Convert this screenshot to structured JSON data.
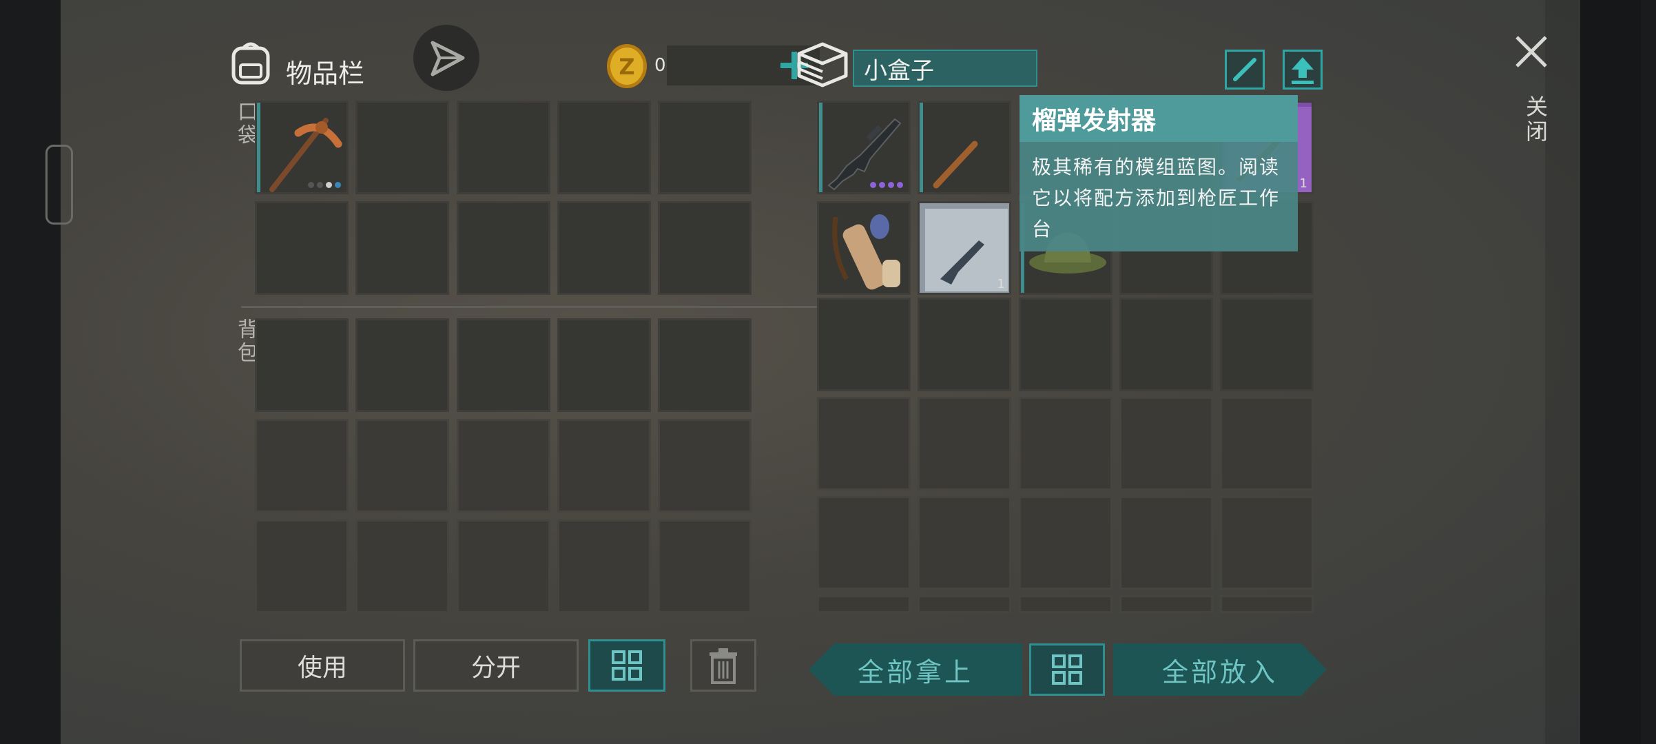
{
  "inventory": {
    "title": "物品栏",
    "pocket_label": "口袋",
    "backpack_label": "背包",
    "coins": "0"
  },
  "container": {
    "name": "小盒子"
  },
  "tooltip": {
    "title": "榴弹发射器",
    "description": "极其稀有的模组蓝图。阅读它以将配方添加到枪匠工作台"
  },
  "items": {
    "blueprint_qty": "1",
    "rifle_blueprint_qty": "1"
  },
  "buttons": {
    "use": "使用",
    "split": "分开",
    "take_all": "全部拿上",
    "put_all": "全部放入"
  },
  "close_label": "关闭",
  "colors": {
    "accent": "#2f8f8f",
    "tooltip": "#4a8686",
    "coin": "#d9a520",
    "rarity_purple": "#8e62d8"
  }
}
